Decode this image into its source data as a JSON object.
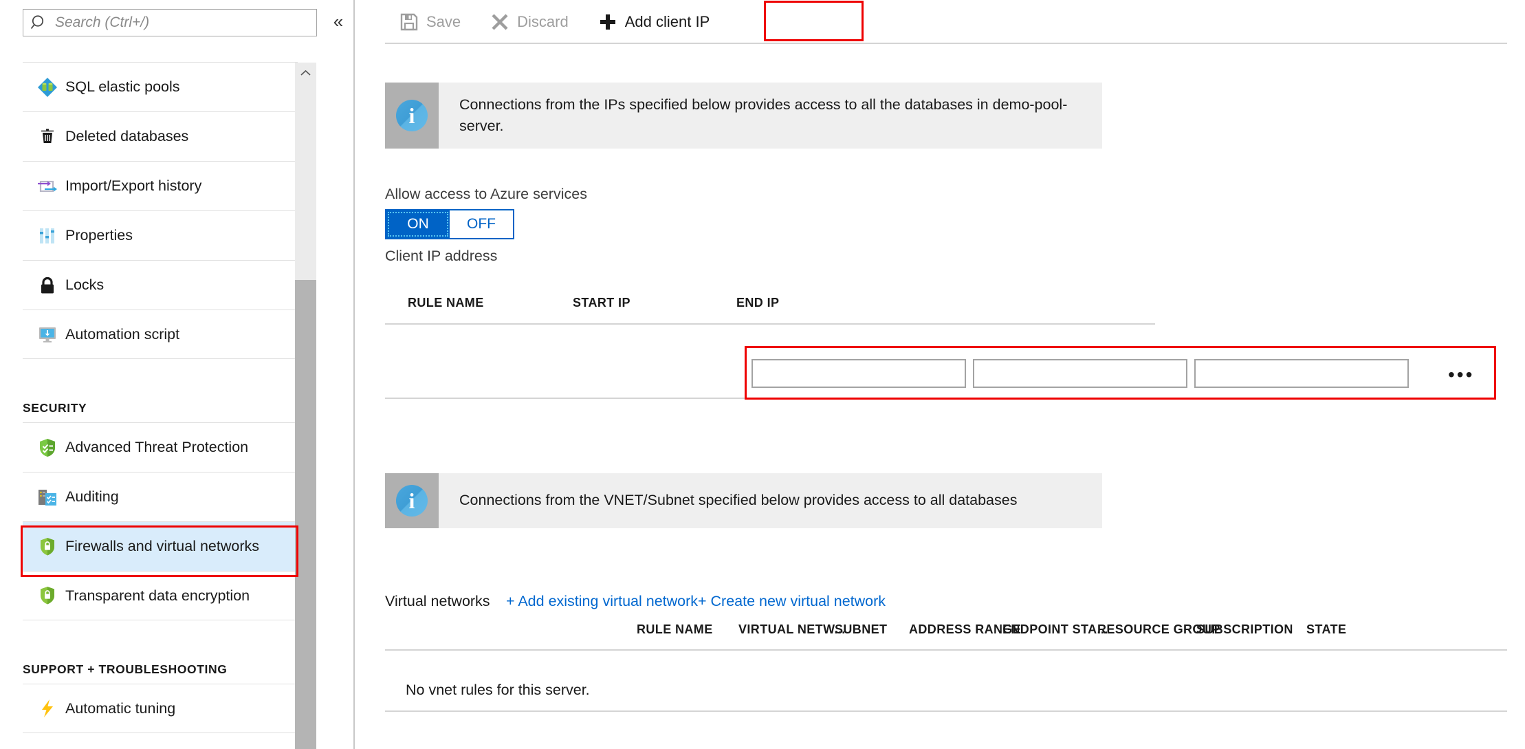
{
  "sidebar": {
    "search": {
      "placeholder": "Search (Ctrl+/)",
      "value": "",
      "icon": "search-icon"
    },
    "collapse_label": "«",
    "items": [
      {
        "label": "SQL elastic pools",
        "icon": "sql-elastic-pools-icon",
        "selected": false
      },
      {
        "label": "Deleted databases",
        "icon": "trash-icon",
        "selected": false
      },
      {
        "label": "Import/Export history",
        "icon": "import-export-icon",
        "selected": false
      },
      {
        "label": "Properties",
        "icon": "sliders-icon",
        "selected": false
      },
      {
        "label": "Locks",
        "icon": "lock-icon",
        "selected": false
      },
      {
        "label": "Automation script",
        "icon": "monitor-download-icon",
        "selected": false
      }
    ],
    "security_group_title": "SECURITY",
    "security_items": [
      {
        "label": "Advanced Threat Protection",
        "icon": "shield-check-icon",
        "selected": false
      },
      {
        "label": "Auditing",
        "icon": "auditing-icon",
        "selected": false
      },
      {
        "label": "Firewalls and virtual networks",
        "icon": "shield-lock-icon",
        "selected": true
      },
      {
        "label": "Transparent data encryption",
        "icon": "shield-lock-icon",
        "selected": false
      }
    ],
    "support_group_title": "SUPPORT + TROUBLESHOOTING",
    "support_items": [
      {
        "label": "Automatic tuning",
        "icon": "lightning-bolt-icon",
        "selected": false
      }
    ]
  },
  "toolbar": {
    "save_label": "Save",
    "discard_label": "Discard",
    "add_client_ip_label": "Add client IP"
  },
  "main": {
    "info_banner_1": "Connections from the IPs specified below provides access to all the databases in demo-pool-server.",
    "azure_services_label": "Allow access to Azure services",
    "toggle_on_label": "ON",
    "toggle_off_label": "OFF",
    "client_ip_label": "Client IP address",
    "ip_table": {
      "headers": [
        "RULE NAME",
        "START IP",
        "END IP"
      ],
      "row": {
        "rule_name": "",
        "start_ip": "",
        "end_ip": "",
        "more_label": "•••"
      }
    },
    "info_banner_2": "Connections from the VNET/Subnet specified below provides access to all databases",
    "vnet_label": "Virtual networks",
    "add_existing_vnet_label": "+ Add existing virtual network",
    "create_new_vnet_label": "+ Create new virtual network",
    "vnet_table": {
      "headers": [
        "RULE NAME",
        "VIRTUAL NETW...",
        "SUBNET",
        "ADDRESS RANGE",
        "ENDPOINT STA...",
        "RESOURCE GROUP",
        "SUBSCRIPTION",
        "STATE"
      ],
      "empty_message": "No vnet rules for this server."
    }
  },
  "colors": {
    "accent_blue": "#0067cf",
    "toggle_blue": "#0063c6",
    "highlight_red": "#ee0000",
    "selected_row_blue": "#d9ecfb",
    "banner_grey": "#efefef"
  }
}
